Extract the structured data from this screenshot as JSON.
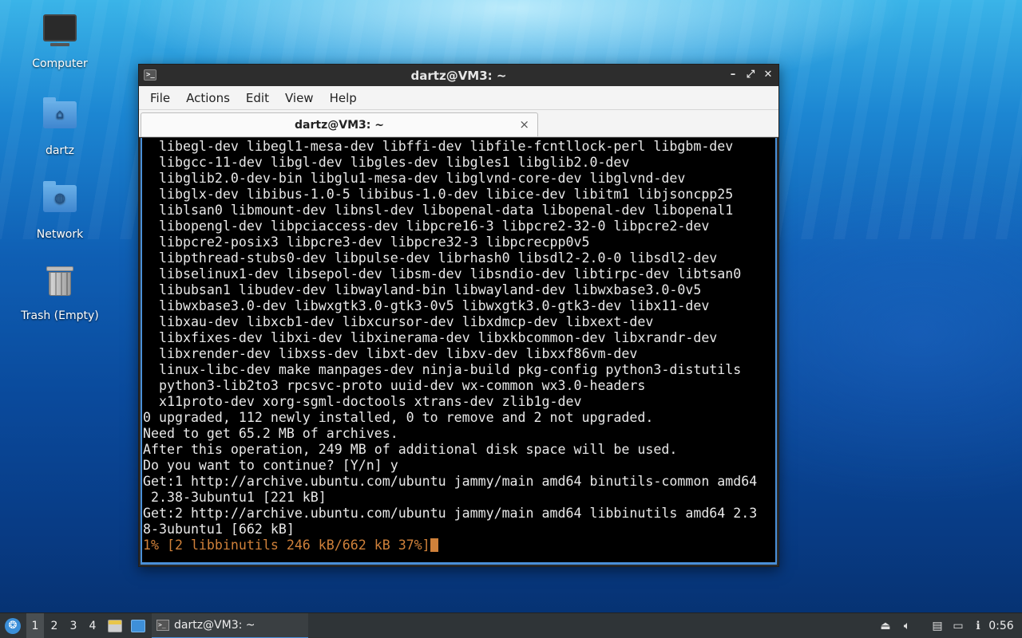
{
  "desktop": {
    "icons": [
      {
        "label": "Computer",
        "icon": "computer-icon"
      },
      {
        "label": "dartz",
        "icon": "home-folder-icon"
      },
      {
        "label": "Network",
        "icon": "network-folder-icon"
      },
      {
        "label": "Trash (Empty)",
        "icon": "trash-icon"
      }
    ]
  },
  "window": {
    "title": "dartz@VM3: ~",
    "menu": [
      "File",
      "Actions",
      "Edit",
      "View",
      "Help"
    ],
    "tab_label": "dartz@VM3: ~",
    "terminal_lines": [
      "  libegl-dev libegl1-mesa-dev libffi-dev libfile-fcntllock-perl libgbm-dev",
      "  libgcc-11-dev libgl-dev libgles-dev libgles1 libglib2.0-dev",
      "  libglib2.0-dev-bin libglu1-mesa-dev libglvnd-core-dev libglvnd-dev",
      "  libglx-dev libibus-1.0-5 libibus-1.0-dev libice-dev libitm1 libjsoncpp25",
      "  liblsan0 libmount-dev libnsl-dev libopenal-data libopenal-dev libopenal1",
      "  libopengl-dev libpciaccess-dev libpcre16-3 libpcre2-32-0 libpcre2-dev",
      "  libpcre2-posix3 libpcre3-dev libpcre32-3 libpcrecpp0v5",
      "  libpthread-stubs0-dev libpulse-dev librhash0 libsdl2-2.0-0 libsdl2-dev",
      "  libselinux1-dev libsepol-dev libsm-dev libsndio-dev libtirpc-dev libtsan0",
      "  libubsan1 libudev-dev libwayland-bin libwayland-dev libwxbase3.0-0v5",
      "  libwxbase3.0-dev libwxgtk3.0-gtk3-0v5 libwxgtk3.0-gtk3-dev libx11-dev",
      "  libxau-dev libxcb1-dev libxcursor-dev libxdmcp-dev libxext-dev",
      "  libxfixes-dev libxi-dev libxinerama-dev libxkbcommon-dev libxrandr-dev",
      "  libxrender-dev libxss-dev libxt-dev libxv-dev libxxf86vm-dev",
      "  linux-libc-dev make manpages-dev ninja-build pkg-config python3-distutils",
      "  python3-lib2to3 rpcsvc-proto uuid-dev wx-common wx3.0-headers",
      "  x11proto-dev xorg-sgml-doctools xtrans-dev zlib1g-dev",
      "0 upgraded, 112 newly installed, 0 to remove and 2 not upgraded.",
      "Need to get 65.2 MB of archives.",
      "After this operation, 249 MB of additional disk space will be used.",
      "Do you want to continue? [Y/n] y",
      "Get:1 http://archive.ubuntu.com/ubuntu jammy/main amd64 binutils-common amd64",
      " 2.38-3ubuntu1 [221 kB]",
      "Get:2 http://archive.ubuntu.com/ubuntu jammy/main amd64 libbinutils amd64 2.3",
      "8-3ubuntu1 [662 kB]"
    ],
    "progress_line": "1% [2 libbinutils 246 kB/662 kB 37%]"
  },
  "taskbar": {
    "workspaces": [
      "1",
      "2",
      "3",
      "4"
    ],
    "active_workspace": "1",
    "window_button": "dartz@VM3: ~",
    "clock": "0:56",
    "accent": "#4a90d9"
  }
}
